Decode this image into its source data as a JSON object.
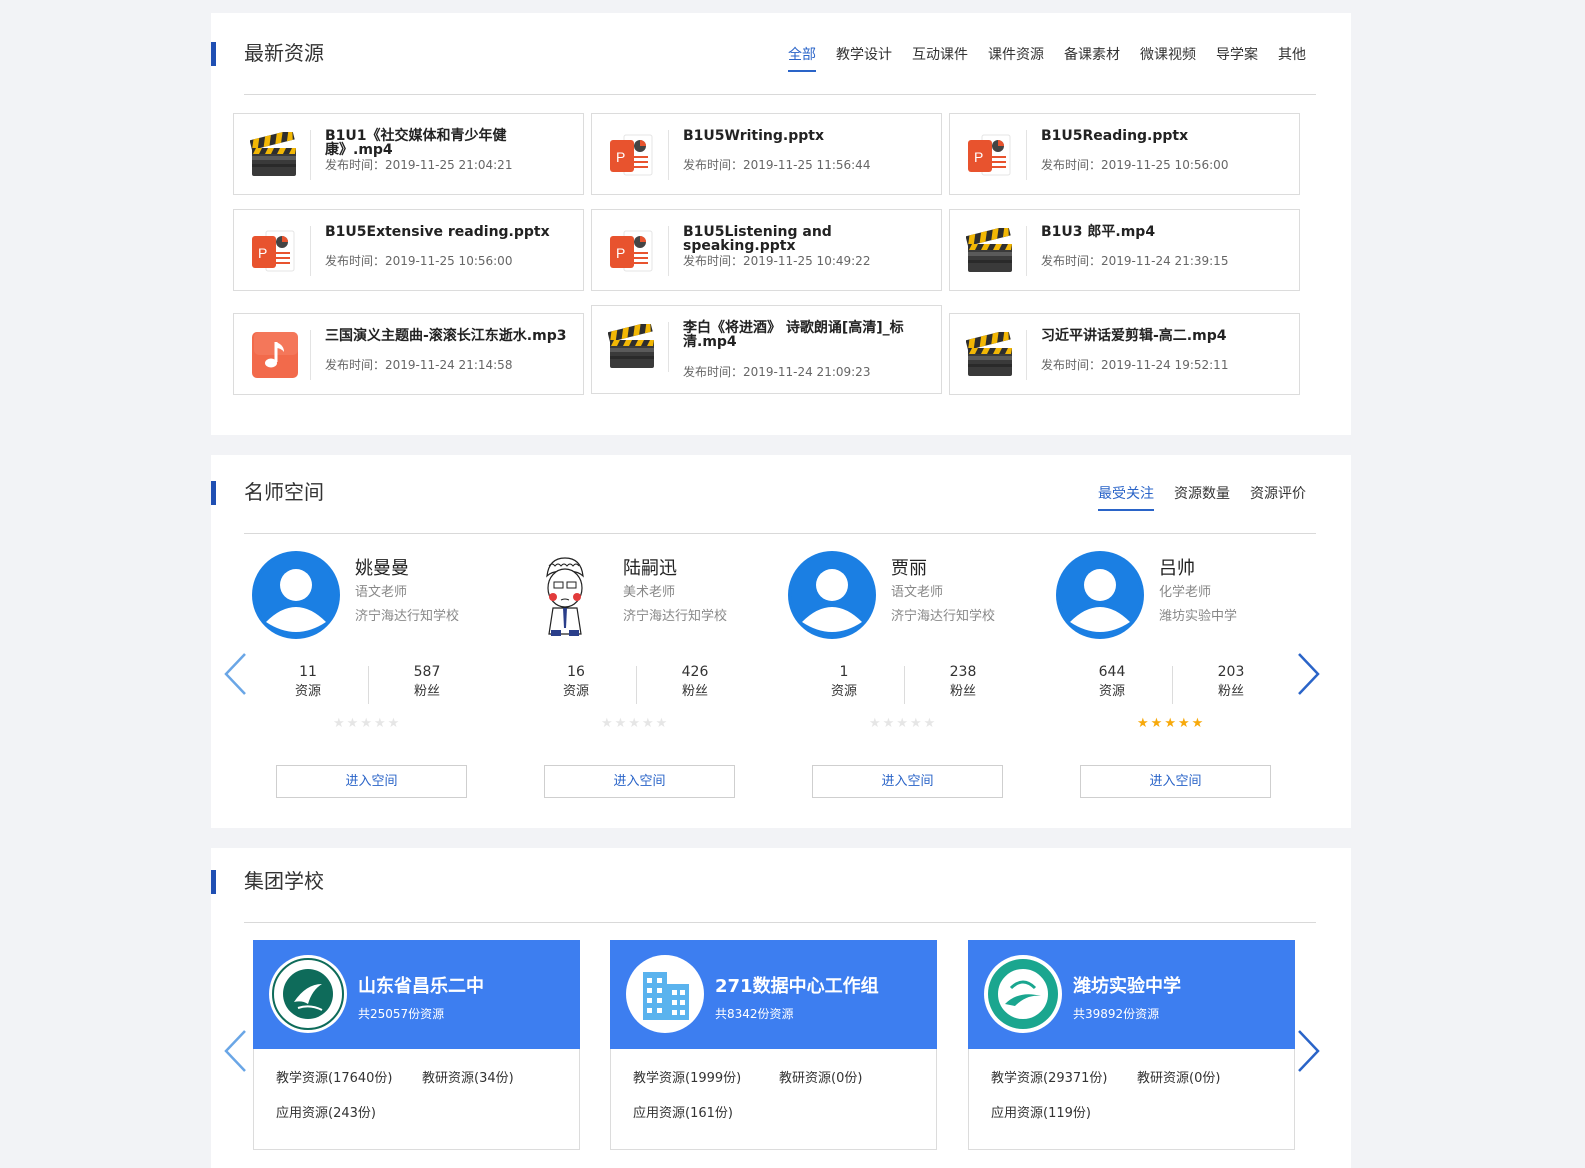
{
  "resources_section": {
    "title": "最新资源",
    "tabs": [
      "全部",
      "教学设计",
      "互动课件",
      "课件资源",
      "备课素材",
      "微课视频",
      "导学案",
      "其他"
    ],
    "active_tab": "全部",
    "items": [
      {
        "name": "B1U1《社交媒体和青少年健康》.mp4",
        "time": "发布时间：2019-11-25 21:04:21",
        "icon": "video-clapper-icon"
      },
      {
        "name": "B1U5Writing.pptx",
        "time": "发布时间：2019-11-25 11:56:44",
        "icon": "ppt-icon"
      },
      {
        "name": "B1U5Reading.pptx",
        "time": "发布时间：2019-11-25 10:56:00",
        "icon": "ppt-icon"
      },
      {
        "name": "B1U5Extensive reading.pptx",
        "time": "发布时间：2019-11-25 10:56:00",
        "icon": "ppt-icon"
      },
      {
        "name": "B1U5Listening and speaking.pptx",
        "time": "发布时间：2019-11-25 10:49:22",
        "icon": "ppt-icon"
      },
      {
        "name": "B1U3 郎平.mp4",
        "time": "发布时间：2019-11-24 21:39:15",
        "icon": "video-clapper-icon"
      },
      {
        "name": "三国演义主题曲-滚滚长江东逝水.mp3",
        "time": "发布时间：2019-11-24 21:14:58",
        "icon": "music-icon"
      },
      {
        "name": "李白《将进酒》 诗歌朗诵[高清]_标清.mp4",
        "time": "发布时间：2019-11-24 21:09:23",
        "icon": "video-clapper-icon"
      },
      {
        "name": "习近平讲话爱剪辑-高二.mp4",
        "time": "发布时间：2019-11-24 19:52:11",
        "icon": "video-clapper-icon"
      }
    ]
  },
  "teachers_section": {
    "title": "名师空间",
    "tabs": [
      "最受关注",
      "资源数量",
      "资源评价"
    ],
    "active_tab": "最受关注",
    "teachers": [
      {
        "name": "姚曼曼",
        "role": "语文老师",
        "school": "济宁海达行知学校",
        "resources": "11",
        "resources_label": "资源",
        "fans": "587",
        "fans_label": "粉丝",
        "rating": 0,
        "avatar": "default-avatar-icon",
        "button": "进入空间"
      },
      {
        "name": "陆嗣迅",
        "role": "美术老师",
        "school": "济宁海达行知学校",
        "resources": "16",
        "resources_label": "资源",
        "fans": "426",
        "fans_label": "粉丝",
        "rating": 0,
        "avatar": "cartoon-avatar",
        "button": "进入空间"
      },
      {
        "name": "贾丽",
        "role": "语文老师",
        "school": "济宁海达行知学校",
        "resources": "1",
        "resources_label": "资源",
        "fans": "238",
        "fans_label": "粉丝",
        "rating": 0,
        "avatar": "default-avatar-icon",
        "button": "进入空间"
      },
      {
        "name": "吕帅",
        "role": "化学老师",
        "school": "潍坊实验中学",
        "resources": "644",
        "resources_label": "资源",
        "fans": "203",
        "fans_label": "粉丝",
        "rating": 5,
        "avatar": "default-avatar-icon",
        "button": "进入空间"
      }
    ]
  },
  "schools_section": {
    "title": "集团学校",
    "schools": [
      {
        "name": "山东省昌乐二中",
        "total": "共25057份资源",
        "teaching": "教学资源(17640份)",
        "research": "教研资源(34份)",
        "applied": "应用资源(243份)",
        "logo": "school-seal-logo"
      },
      {
        "name": "271数据中心工作组",
        "total": "共8342份资源",
        "teaching": "教学资源(1999份)",
        "research": "教研资源(0份)",
        "applied": "应用资源(161份)",
        "logo": "building-icon"
      },
      {
        "name": "潍坊实验中学",
        "total": "共39892份资源",
        "teaching": "教学资源(29371份)",
        "research": "教研资源(0份)",
        "applied": "应用资源(119份)",
        "logo": "school-seal-logo"
      }
    ]
  },
  "colors": {
    "accent": "#2a64c8",
    "section_bar": "#1f4fb3",
    "school_header": "#3d7ef0",
    "star_on": "#f7a90b",
    "avatar_blue": "#1b7fe3"
  }
}
